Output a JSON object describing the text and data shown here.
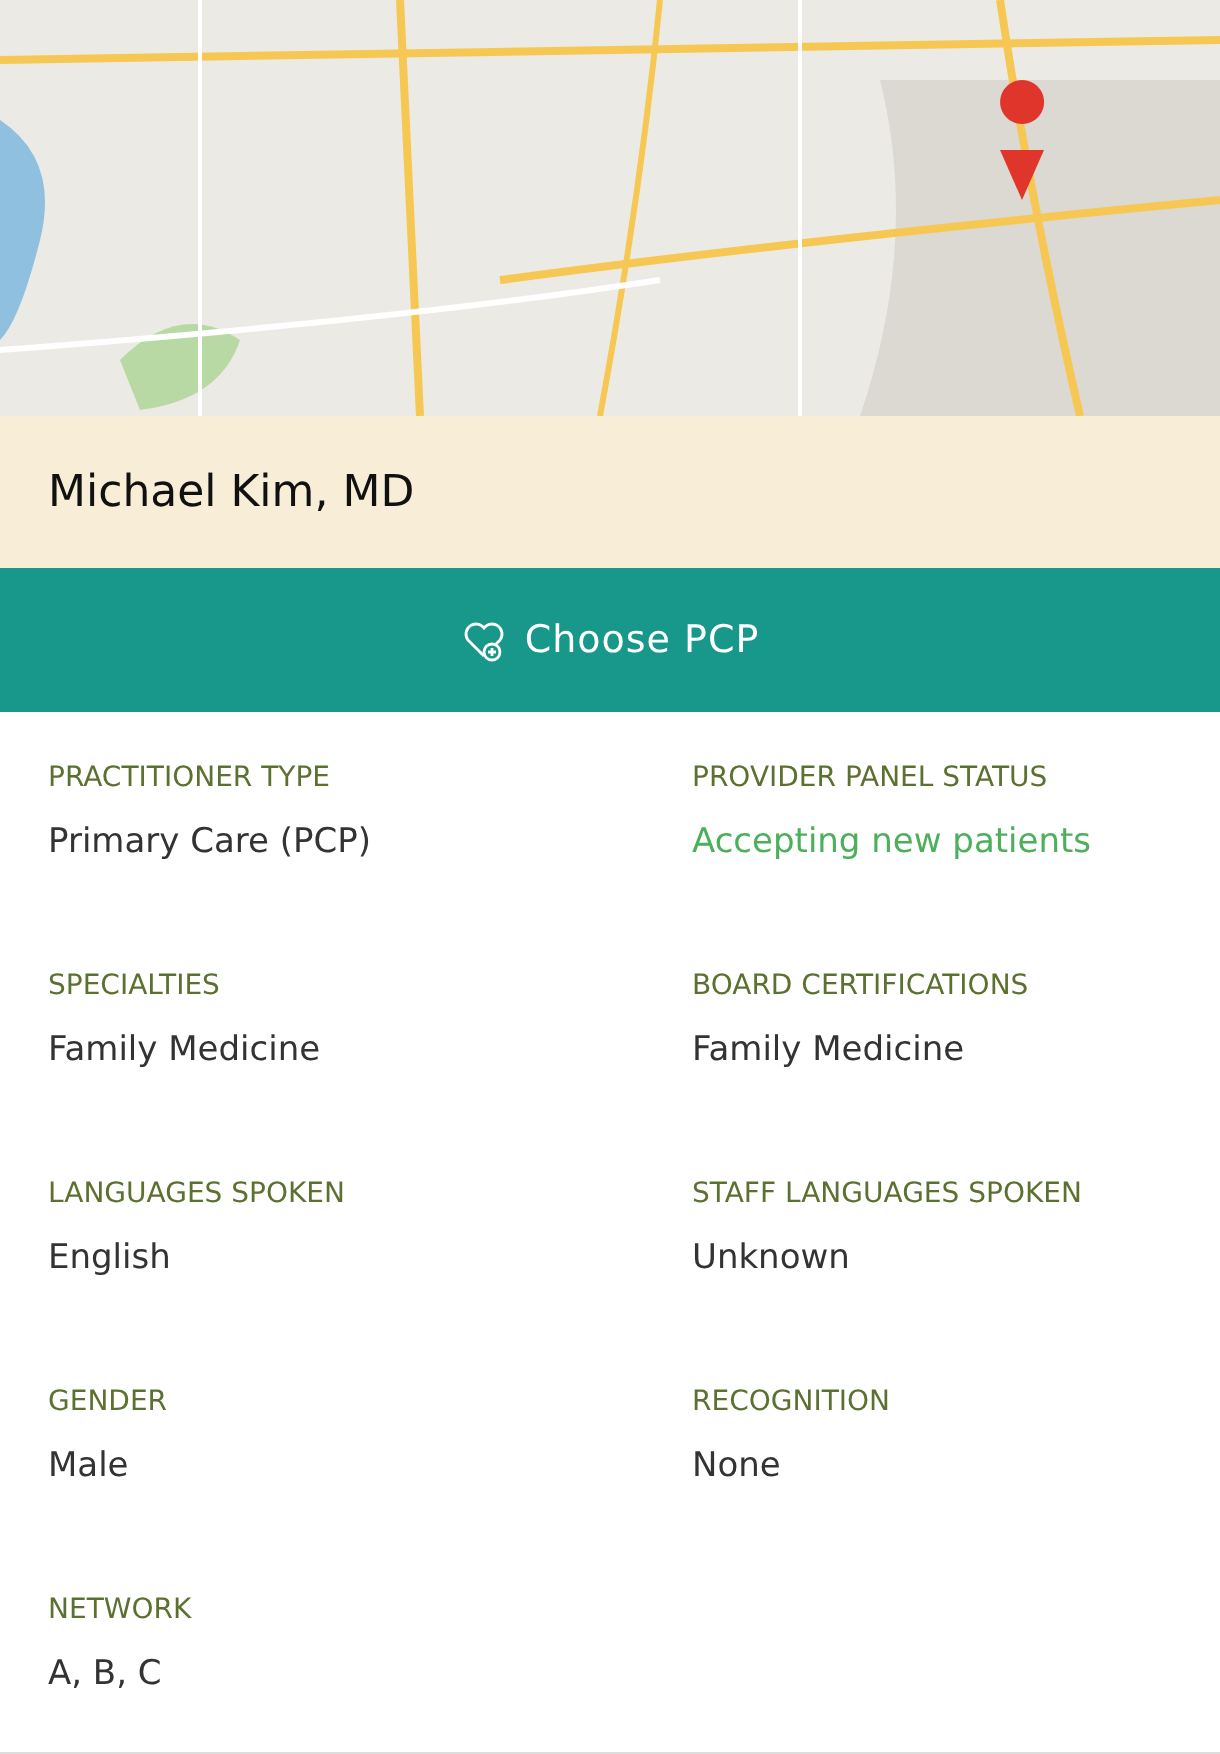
{
  "provider": {
    "name": "Michael Kim, MD"
  },
  "action": {
    "label": "Choose PCP"
  },
  "fields": [
    {
      "label": "PRACTITIONER TYPE",
      "value": "Primary Care (PCP)",
      "kind": "text"
    },
    {
      "label": "PROVIDER PANEL STATUS",
      "value": "Accepting new patients",
      "kind": "status"
    },
    {
      "label": "SPECIALTIES",
      "value": "Family Medicine",
      "kind": "text"
    },
    {
      "label": "BOARD CERTIFICATIONS",
      "value": "Family Medicine",
      "kind": "text"
    },
    {
      "label": "LANGUAGES SPOKEN",
      "value": "English",
      "kind": "text"
    },
    {
      "label": "STAFF LANGUAGES SPOKEN",
      "value": "Unknown",
      "kind": "text"
    },
    {
      "label": "GENDER",
      "value": "Male",
      "kind": "text"
    },
    {
      "label": "RECOGNITION",
      "value": "None",
      "kind": "text"
    },
    {
      "label": "NETWORK",
      "value": "A, B, C",
      "kind": "text"
    }
  ]
}
